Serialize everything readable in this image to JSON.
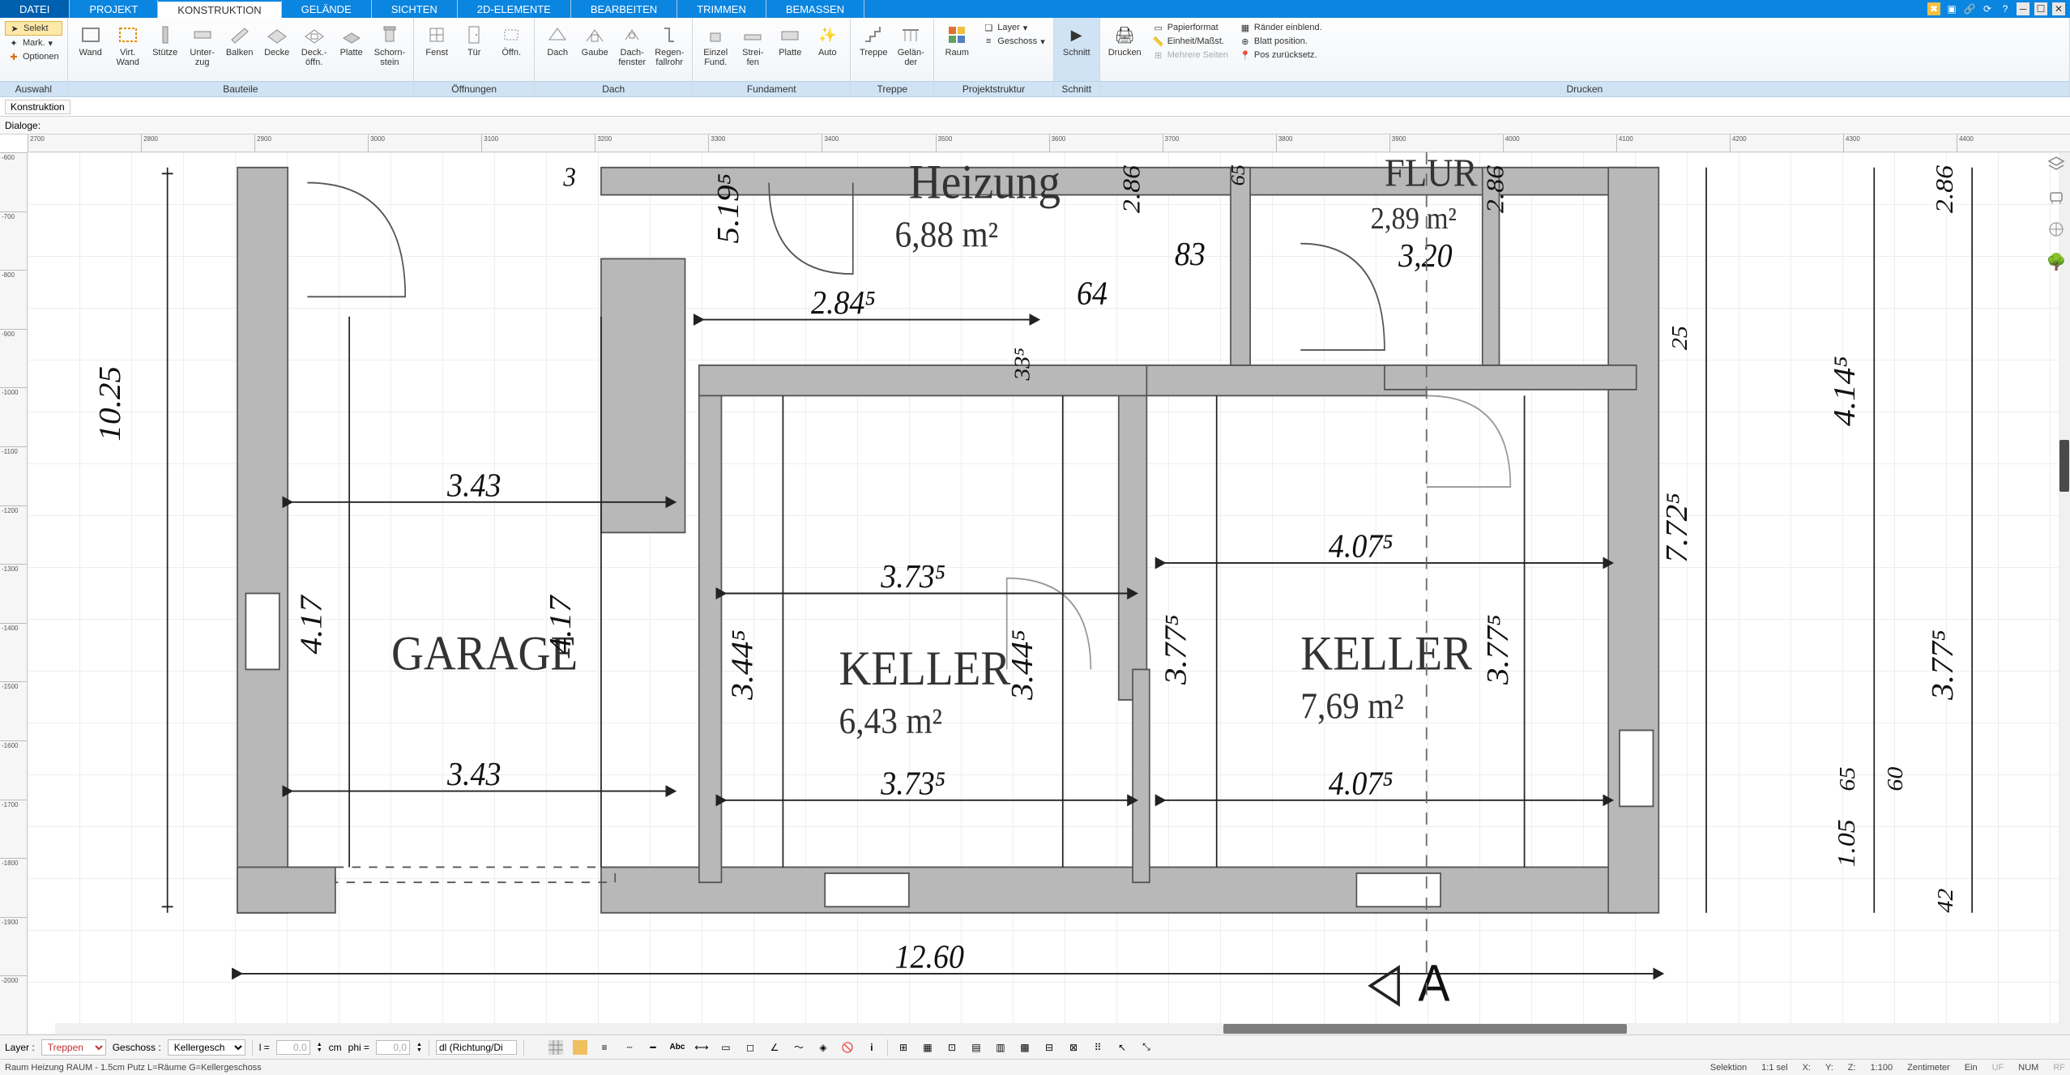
{
  "menu": {
    "tabs": [
      "DATEI",
      "PROJEKT",
      "KONSTRUKTION",
      "GELÄNDE",
      "SICHTEN",
      "2D-ELEMENTE",
      "BEARBEITEN",
      "TRIMMEN",
      "BEMASSEN"
    ],
    "active": 2
  },
  "ribbon": {
    "auswahl": {
      "label": "Auswahl",
      "selekt": "Selekt",
      "mark": "Mark.",
      "optionen": "Optionen"
    },
    "bauteile": {
      "label": "Bauteile",
      "wand": "Wand",
      "virtwand": "Virt.\nWand",
      "stuetze": "Stütze",
      "unterzug": "Unter-\nzug",
      "balken": "Balken",
      "decke": "Decke",
      "deckoeffn": "Deck.-\nöffn.",
      "platte": "Platte",
      "schornstein": "Schorn-\nstein"
    },
    "oeffnungen": {
      "label": "Öffnungen",
      "fenst": "Fenst",
      "tuer": "Tür",
      "oeffn": "Öffn."
    },
    "dach": {
      "label": "Dach",
      "dach": "Dach",
      "gaube": "Gaube",
      "dachfenster": "Dach-\nfenster",
      "fallrohr": "Regen-\nfallrohr"
    },
    "fundament": {
      "label": "Fundament",
      "einzel": "Einzel\nFund.",
      "streifen": "Strei-\nfen",
      "platte": "Platte",
      "auto": "Auto"
    },
    "treppe": {
      "label": "Treppe",
      "treppe": "Treppe",
      "gelaender": "Gelän-\nder"
    },
    "projektstruktur": {
      "label": "Projektstruktur",
      "raum": "Raum",
      "layer": "Layer",
      "geschoss": "Geschoss"
    },
    "schnitt": {
      "label": "Schnitt",
      "schnitt": "Schnitt"
    },
    "drucken": {
      "label": "Drucken",
      "drucken": "Drucken",
      "papierformat": "Papierformat",
      "einheit": "Einheit/Maßst.",
      "mehrere": "Mehrere Seiten",
      "raender": "Ränder einblend.",
      "blattpos": "Blatt position.",
      "posreset": "Pos zurücksetz."
    }
  },
  "subbar": {
    "konstruktion": "Konstruktion"
  },
  "subbar2": {
    "dialoge": "Dialoge:"
  },
  "rooms": {
    "heizung": {
      "name": "Heizung",
      "area": "6,88 m²"
    },
    "garage": {
      "name": "GARAGE"
    },
    "keller1": {
      "name": "KELLER",
      "area": "6,43 m²"
    },
    "keller2": {
      "name": "KELLER",
      "area": "7,69 m²"
    },
    "flur": {
      "name": "FLUR",
      "area": "2,89 m²"
    }
  },
  "dims": {
    "d1025": "10.25",
    "d343a": "3.43",
    "d343b": "3.43",
    "d417a": "4.17",
    "d417b": "4.17",
    "d2845": "2.84⁵",
    "d5195": "5.19⁵",
    "d64": "64",
    "d83": "83",
    "d286a": "2.86",
    "d286b": "2.86",
    "d286c": "2.86",
    "d65": "65",
    "d320": "3,20",
    "d3735a": "3.73⁵",
    "d3735b": "3.73⁵",
    "d3445a": "3.44⁵",
    "d3445b": "3.44⁵",
    "d335": "33⁵",
    "d4075a": "4.07⁵",
    "d4075b": "4.07⁵",
    "d3775a": "3.77⁵",
    "d3775b": "3.77⁵",
    "d3775c": "3.77⁵",
    "d7725": "7.72⁵",
    "d4145": "4.14⁵",
    "d25": "25",
    "d65b": "65",
    "d60": "60",
    "d105": "1.05",
    "d42": "42",
    "d1260": "12.60",
    "d3": "3"
  },
  "ruler_h": [
    "2700",
    "2800",
    "2900",
    "3000",
    "3100",
    "3200",
    "3300",
    "3400",
    "3500",
    "3600",
    "3700",
    "3800",
    "3900",
    "4000",
    "4100",
    "4200",
    "4300",
    "4400"
  ],
  "ruler_v": [
    "-600",
    "-700",
    "-800",
    "-900",
    "-1000",
    "-1100",
    "-1200",
    "-1300",
    "-1400",
    "-1500",
    "-1600",
    "-1700",
    "-1800",
    "-1900",
    "-2000"
  ],
  "bottom": {
    "layer_lbl": "Layer :",
    "layer_val": "Treppen",
    "geschoss_lbl": "Geschoss :",
    "geschoss_val": "Kellergesch",
    "l_lbl": "l =",
    "l_val": "0,0",
    "unit": "cm",
    "phi_lbl": "phi =",
    "phi_val": "0,0",
    "dl": "dl (Richtung/Di"
  },
  "status": {
    "msg": "Raum Heizung RAUM - 1.5cm Putz L=Räume G=Kellergeschoss",
    "selektion": "Selektion",
    "sel": "1:1 sel",
    "x": "X:",
    "y": "Y:",
    "z": "Z:",
    "scale": "1:100",
    "unit": "Zentimeter",
    "ein": "Ein",
    "uf": "UF",
    "num": "NUM",
    "rf": "RF"
  }
}
